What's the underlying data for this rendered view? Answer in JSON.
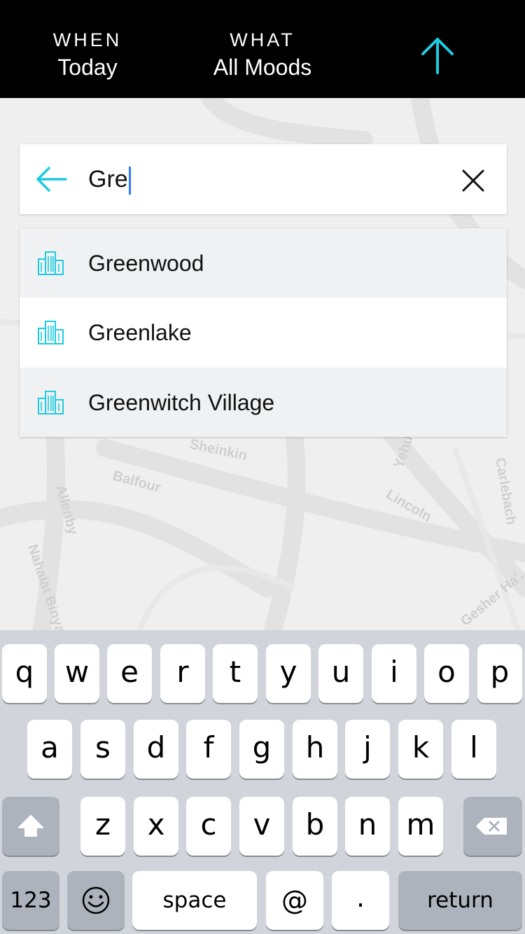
{
  "header": {
    "when_caption": "WHEN",
    "when_value": "Today",
    "what_caption": "WHAT",
    "what_value": "All Moods",
    "up_icon": "arrow-up-icon",
    "accent": "#1ecbe1"
  },
  "map": {
    "streets": [
      "Sheinkin",
      "Balfour",
      "Allenby",
      "Nahalat Binyamin",
      "Lincoln",
      "Yehuda",
      "Carlebach",
      "Gesher Ha'..."
    ]
  },
  "search": {
    "value": "Gre",
    "back_icon": "arrow-left-icon",
    "clear_icon": "close-icon"
  },
  "suggestions": [
    {
      "label": "Greenwood",
      "icon": "city-buildings-icon"
    },
    {
      "label": "Greenlake",
      "icon": "city-buildings-icon"
    },
    {
      "label": "Greenwitch Village",
      "icon": "city-buildings-icon"
    }
  ],
  "keyboard": {
    "row1": [
      "q",
      "w",
      "e",
      "r",
      "t",
      "y",
      "u",
      "i",
      "o",
      "p"
    ],
    "row2": [
      "a",
      "s",
      "d",
      "f",
      "g",
      "h",
      "j",
      "k",
      "l"
    ],
    "row3": [
      "z",
      "x",
      "c",
      "v",
      "b",
      "n",
      "m"
    ],
    "numbers_label": "123",
    "space_label": "space",
    "at_label": "@",
    "dot_label": ".",
    "return_label": "return"
  }
}
